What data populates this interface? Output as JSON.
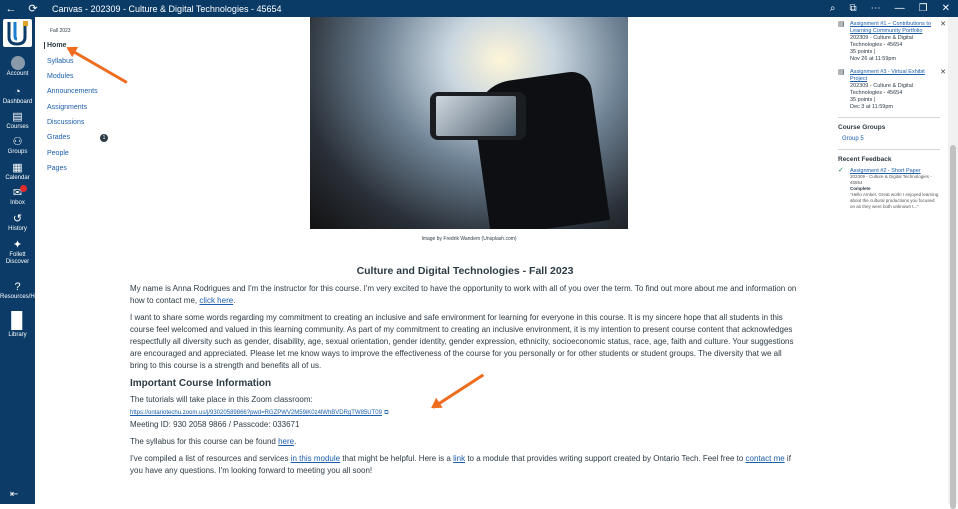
{
  "window": {
    "title": "Canvas - 202309 - Culture & Digital Technologies - 45654"
  },
  "global_nav": [
    {
      "label": "Account",
      "icon": "account-icon"
    },
    {
      "label": "Dashboard",
      "icon": "dashboard-icon"
    },
    {
      "label": "Courses",
      "icon": "courses-icon"
    },
    {
      "label": "Groups",
      "icon": "groups-icon"
    },
    {
      "label": "Calendar",
      "icon": "calendar-icon"
    },
    {
      "label": "Inbox",
      "icon": "inbox-icon"
    },
    {
      "label": "History",
      "icon": "history-icon"
    },
    {
      "label": "Follett Discover",
      "icon": "follett-icon"
    },
    {
      "label": "Resources/Help",
      "icon": "help-icon"
    },
    {
      "label": "Library",
      "icon": "library-icon"
    }
  ],
  "course_nav": {
    "term": "Fall 2023",
    "items": [
      {
        "label": "Home"
      },
      {
        "label": "Syllabus"
      },
      {
        "label": "Modules"
      },
      {
        "label": "Announcements"
      },
      {
        "label": "Assignments"
      },
      {
        "label": "Discussions"
      },
      {
        "label": "Grades",
        "badge": "1"
      },
      {
        "label": "People"
      },
      {
        "label": "Pages"
      }
    ]
  },
  "hero": {
    "caption": "Image by Fredrik Wandem (Unsplash.com)"
  },
  "content": {
    "title": "Culture and Digital Technologies - Fall 2023",
    "intro_text": "My name is Anna Rodrigues and I'm the instructor for this course. I'm very excited to have the opportunity to work with all of you over the term. To find out more about me and information on how to contact me,",
    "intro_link": "click here",
    "inclusion_text": "I want to share some words regarding my commitment to creating an inclusive and safe environment for learning for everyone in this course. It is my sincere hope that all students in this course feel welcomed and valued in this learning community. As part of my commitment to creating an inclusive environment, it is my intention to present course content that acknowledges respectfully all diversity such as gender, disability, age, sexual orientation, gender identity, gender expression, ethnicity, socioeconomic status, race, age, faith and culture. Your suggestions are encouraged and appreciated. Please let me know ways to improve the effectiveness of the course for you personally or for other students or student groups. The diversity that we all bring to this course is a strength and benefits all of us.",
    "important_heading": "Important Course Information",
    "zoom_intro": "The tutorials will take place in this Zoom classroom:",
    "zoom_link": "https://ontariotechu.zoom.us/j/93020589866?pwd=RGZPWV2M59iK0z4lWhBVDRgTW85UT09",
    "meeting_id": "Meeting ID: 930 2058 9866 / Passcode: 033671",
    "syllabus_text": "The syllabus for this course can be found",
    "syllabus_link": "here",
    "resources_text_1": "I've compiled a list of resources and services",
    "resources_link_1": "in this module",
    "resources_text_2": "that might be helpful. Here is a",
    "resources_link_2": "link",
    "resources_text_3": "to a module that provides writing support created by Ontario Tech. Feel free to",
    "resources_link_3": "contact me",
    "resources_text_4": "if you have any questions.  I'm looking forward to meeting you all soon!"
  },
  "right_col": {
    "todos": [
      {
        "title": "Assignment #1 – Contributions to Learning Community Portfolio",
        "course": "202309 - Culture & Digital Technologies - 45654",
        "points": "35 points",
        "due": "Nov 26 at 11:59pm"
      },
      {
        "title": "Assignment #3 - Virtual Exhibit Project",
        "course": "202309 - Culture & Digital Technologies - 45654",
        "points": "35 points",
        "due": "Dec 3 at 11:59pm"
      }
    ],
    "groups_heading": "Course Groups",
    "group_name": "Group 5",
    "feedback_heading": "Recent Feedback",
    "feedback": {
      "title": "Assignment #2 - Short Paper",
      "course": "202309 - Culture & Digital Technologies - 45654",
      "status": "Complete",
      "comment": "\"Hello Amber, Great work! I enjoyed learning about the cultural productions you focused on as they were both unknown t...\""
    }
  },
  "colors": {
    "nav_bg": "#0b3b66",
    "link": "#1a5dab",
    "annotation_arrow": "#ef6c1f"
  }
}
